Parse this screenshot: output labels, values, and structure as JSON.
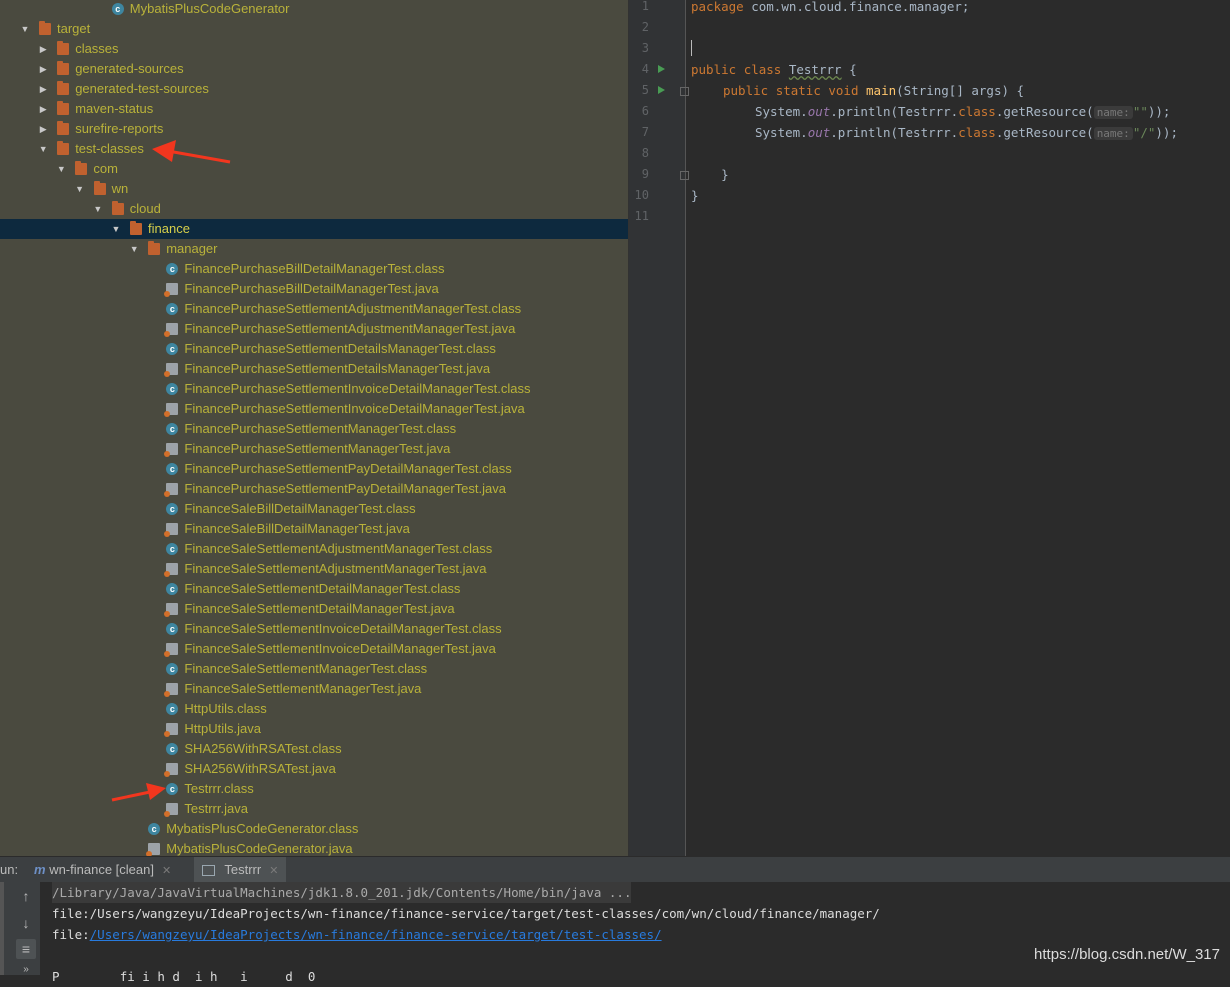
{
  "tree": {
    "rows": [
      {
        "label": "MybatisPlusCodeGenerator",
        "icon": "class",
        "indent": 5,
        "arrow": ""
      },
      {
        "label": "target",
        "icon": "folder",
        "indent": 1,
        "arrow": "expanded"
      },
      {
        "label": "classes",
        "icon": "folder",
        "indent": 2,
        "arrow": "collapsed"
      },
      {
        "label": "generated-sources",
        "icon": "folder",
        "indent": 2,
        "arrow": "collapsed"
      },
      {
        "label": "generated-test-sources",
        "icon": "folder",
        "indent": 2,
        "arrow": "collapsed"
      },
      {
        "label": "maven-status",
        "icon": "folder",
        "indent": 2,
        "arrow": "collapsed"
      },
      {
        "label": "surefire-reports",
        "icon": "folder",
        "indent": 2,
        "arrow": "collapsed"
      },
      {
        "label": "test-classes",
        "icon": "folder",
        "indent": 2,
        "arrow": "expanded"
      },
      {
        "label": "com",
        "icon": "folder",
        "indent": 3,
        "arrow": "expanded"
      },
      {
        "label": "wn",
        "icon": "folder",
        "indent": 4,
        "arrow": "expanded"
      },
      {
        "label": "cloud",
        "icon": "folder",
        "indent": 5,
        "arrow": "expanded"
      },
      {
        "label": "finance",
        "icon": "folder",
        "indent": 6,
        "arrow": "expanded",
        "selected": true
      },
      {
        "label": "manager",
        "icon": "folder",
        "indent": 7,
        "arrow": "expanded"
      },
      {
        "label": "FinancePurchaseBillDetailManagerTest.class",
        "icon": "class",
        "indent": 8,
        "arrow": ""
      },
      {
        "label": "FinancePurchaseBillDetailManagerTest.java",
        "icon": "java",
        "indent": 8,
        "arrow": ""
      },
      {
        "label": "FinancePurchaseSettlementAdjustmentManagerTest.class",
        "icon": "class",
        "indent": 8,
        "arrow": ""
      },
      {
        "label": "FinancePurchaseSettlementAdjustmentManagerTest.java",
        "icon": "java",
        "indent": 8,
        "arrow": ""
      },
      {
        "label": "FinancePurchaseSettlementDetailsManagerTest.class",
        "icon": "class",
        "indent": 8,
        "arrow": ""
      },
      {
        "label": "FinancePurchaseSettlementDetailsManagerTest.java",
        "icon": "java",
        "indent": 8,
        "arrow": ""
      },
      {
        "label": "FinancePurchaseSettlementInvoiceDetailManagerTest.class",
        "icon": "class",
        "indent": 8,
        "arrow": ""
      },
      {
        "label": "FinancePurchaseSettlementInvoiceDetailManagerTest.java",
        "icon": "java",
        "indent": 8,
        "arrow": ""
      },
      {
        "label": "FinancePurchaseSettlementManagerTest.class",
        "icon": "class",
        "indent": 8,
        "arrow": ""
      },
      {
        "label": "FinancePurchaseSettlementManagerTest.java",
        "icon": "java",
        "indent": 8,
        "arrow": ""
      },
      {
        "label": "FinancePurchaseSettlementPayDetailManagerTest.class",
        "icon": "class",
        "indent": 8,
        "arrow": ""
      },
      {
        "label": "FinancePurchaseSettlementPayDetailManagerTest.java",
        "icon": "java",
        "indent": 8,
        "arrow": ""
      },
      {
        "label": "FinanceSaleBillDetailManagerTest.class",
        "icon": "class",
        "indent": 8,
        "arrow": ""
      },
      {
        "label": "FinanceSaleBillDetailManagerTest.java",
        "icon": "java",
        "indent": 8,
        "arrow": ""
      },
      {
        "label": "FinanceSaleSettlementAdjustmentManagerTest.class",
        "icon": "class",
        "indent": 8,
        "arrow": ""
      },
      {
        "label": "FinanceSaleSettlementAdjustmentManagerTest.java",
        "icon": "java",
        "indent": 8,
        "arrow": ""
      },
      {
        "label": "FinanceSaleSettlementDetailManagerTest.class",
        "icon": "class",
        "indent": 8,
        "arrow": ""
      },
      {
        "label": "FinanceSaleSettlementDetailManagerTest.java",
        "icon": "java",
        "indent": 8,
        "arrow": ""
      },
      {
        "label": "FinanceSaleSettlementInvoiceDetailManagerTest.class",
        "icon": "class",
        "indent": 8,
        "arrow": ""
      },
      {
        "label": "FinanceSaleSettlementInvoiceDetailManagerTest.java",
        "icon": "java",
        "indent": 8,
        "arrow": ""
      },
      {
        "label": "FinanceSaleSettlementManagerTest.class",
        "icon": "class",
        "indent": 8,
        "arrow": ""
      },
      {
        "label": "FinanceSaleSettlementManagerTest.java",
        "icon": "java",
        "indent": 8,
        "arrow": ""
      },
      {
        "label": "HttpUtils.class",
        "icon": "class",
        "indent": 8,
        "arrow": ""
      },
      {
        "label": "HttpUtils.java",
        "icon": "java",
        "indent": 8,
        "arrow": ""
      },
      {
        "label": "SHA256WithRSATest.class",
        "icon": "class",
        "indent": 8,
        "arrow": ""
      },
      {
        "label": "SHA256WithRSATest.java",
        "icon": "java",
        "indent": 8,
        "arrow": ""
      },
      {
        "label": "Testrrr.class",
        "icon": "class",
        "indent": 8,
        "arrow": ""
      },
      {
        "label": "Testrrr.java",
        "icon": "java",
        "indent": 8,
        "arrow": ""
      },
      {
        "label": "MybatisPlusCodeGenerator.class",
        "icon": "class",
        "indent": 7,
        "arrow": ""
      },
      {
        "label": "MybatisPlusCodeGenerator.java",
        "icon": "java",
        "indent": 7,
        "arrow": ""
      }
    ]
  },
  "editor": {
    "line_numbers": [
      "1",
      "2",
      "3",
      "4",
      "5",
      "6",
      "7",
      "8",
      "9",
      "10",
      "11"
    ],
    "lines": [
      {
        "kw1": "package",
        "rest": " com.wn.cloud.finance.manager;"
      },
      {},
      {},
      {
        "kw1": "public",
        "kw2": "class",
        "name": "Testrrr",
        "tail": " {"
      },
      {
        "kw1": "public",
        "kw2": "static",
        "kw3": "void",
        "fn": "main",
        "tail": "(String[] args) {"
      },
      {
        "obj": "System.",
        "field": "out",
        "call": ".println(Testrrr.",
        "kw": "class",
        "call2": ".getResource(",
        "hint": "name:",
        "str": "\"\"",
        "end": "));"
      },
      {
        "obj": "System.",
        "field": "out",
        "call": ".println(Testrrr.",
        "kw": "class",
        "call2": ".getResource(",
        "hint": "name:",
        "str": "\"/\"",
        "end": "));"
      },
      {},
      {
        "tail": "    }"
      },
      {
        "tail": "}"
      },
      {}
    ]
  },
  "run": {
    "prefix": "un:",
    "tab1": "wn-finance [clean]",
    "tab2": "Testrrr",
    "console": [
      "/Library/Java/JavaVirtualMachines/jdk1.8.0_201.jdk/Contents/Home/bin/java ...",
      "file:/Users/wangzeyu/IdeaProjects/wn-finance/finance-service/target/test-classes/com/wn/cloud/finance/manager/"
    ],
    "line3_prefix": "file:",
    "line3_link": "/Users/wangzeyu/IdeaProjects/wn-finance/finance-service/target/test-classes/",
    "line4_partial": "P        fi i h d  i h   i     d  0"
  },
  "watermark": "https://blog.csdn.net/W_317",
  "colors": {
    "tree_bg": "#4a4a3f",
    "tree_text": "#b9b23a",
    "selection": "#0d293e",
    "editor_bg": "#2b2b2b",
    "annotation_red": "#f2361e"
  }
}
